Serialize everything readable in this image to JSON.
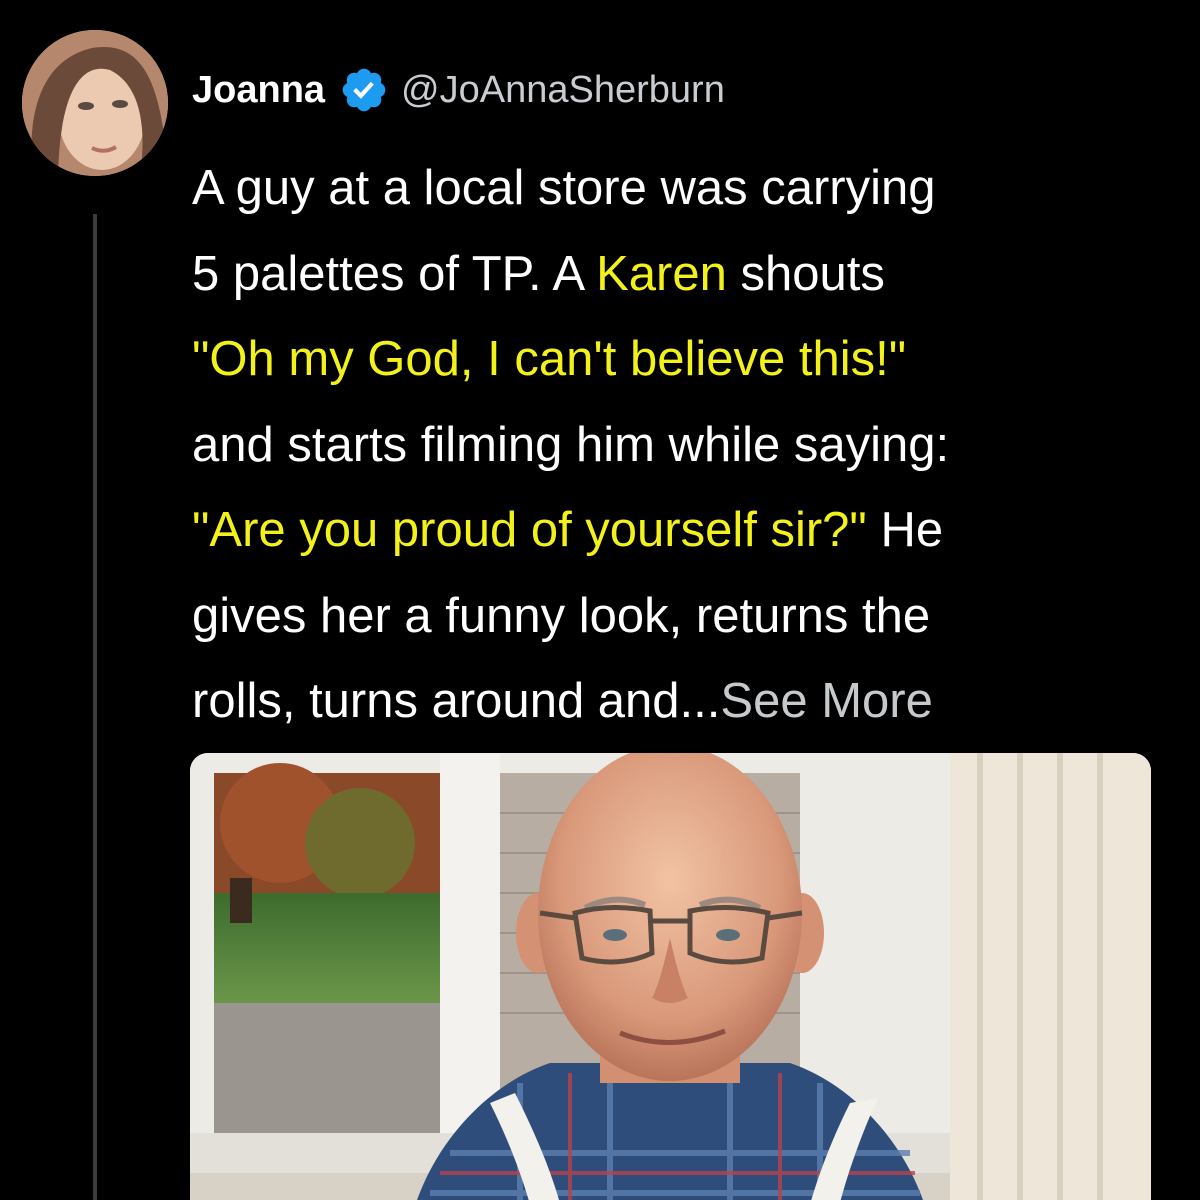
{
  "author": {
    "display_name": "Joanna",
    "handle": "@JoAnnaSherburn",
    "verified": true
  },
  "icons": {
    "verified_badge": "verified-badge-icon"
  },
  "tweet": {
    "lines": [
      [
        {
          "text": "A guy at a local store was carrying",
          "hl": false
        }
      ],
      [
        {
          "text": "5 palettes of TP. A ",
          "hl": false
        },
        {
          "text": "Karen",
          "hl": true
        },
        {
          "text": " shouts",
          "hl": false
        }
      ],
      [
        {
          "text": "\"Oh my God, I can't believe this!\"",
          "hl": true
        }
      ],
      [
        {
          "text": "and starts filming him while saying:",
          "hl": false
        }
      ],
      [
        {
          "text": "\"Are you proud of yourself sir?\"",
          "hl": true
        },
        {
          "text": " He",
          "hl": false
        }
      ],
      [
        {
          "text": "gives her a funny look, returns the",
          "hl": false
        }
      ],
      [
        {
          "text": "rolls, turns around and...",
          "hl": false
        }
      ]
    ],
    "see_more": "See More"
  },
  "colors": {
    "background": "#000000",
    "text": "#ffffff",
    "highlight": "#f2f21a",
    "verified": "#1d9bf0",
    "handle": "#c9ccd0",
    "thread_line": "#3a3d40"
  }
}
